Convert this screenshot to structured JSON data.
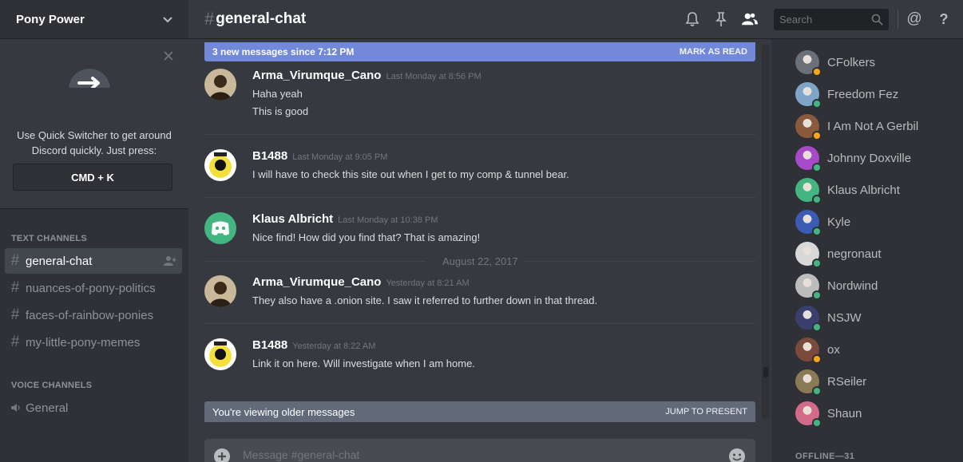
{
  "guild": {
    "name": "Pony Power"
  },
  "quick_switcher": {
    "text": "Use Quick Switcher to get around Discord quickly. Just press:",
    "shortcut": "CMD + K"
  },
  "categories": {
    "text": "TEXT CHANNELS",
    "voice": "VOICE CHANNELS"
  },
  "text_channels": [
    {
      "name": "general-chat",
      "active": true
    },
    {
      "name": "nuances-of-pony-politics"
    },
    {
      "name": "faces-of-rainbow-ponies"
    },
    {
      "name": "my-little-pony-memes"
    }
  ],
  "voice_channels": [
    {
      "name": "General"
    }
  ],
  "header": {
    "channel": "general-chat",
    "search_placeholder": "Search"
  },
  "new_messages": {
    "text": "3 new messages since 7:12 PM",
    "action": "MARK AS READ"
  },
  "messages": [
    {
      "author": "Arma_Virumque_Cano",
      "time": "Last Monday at 8:56 PM",
      "lines": [
        "Haha yeah",
        "This is good"
      ]
    },
    {
      "author": "B1488",
      "time": "Last Monday at 9:05 PM",
      "lines": [
        "I will have to check this site out when I get to my comp & tunnel bear."
      ]
    },
    {
      "author": "Klaus Albricht",
      "time": "Last Monday at 10:38 PM",
      "lines": [
        "Nice find! How did you find that? That is amazing!"
      ]
    },
    {
      "author": "Arma_Virumque_Cano",
      "time": "Yesterday at 8:21 AM",
      "lines": [
        "They also have a .onion site. I saw it referred to further down in that thread."
      ]
    },
    {
      "author": "B1488",
      "time": "Yesterday at 8:22 AM",
      "lines": [
        "Link it on here. Will investigate when I am home."
      ]
    }
  ],
  "date_divider": "August 22, 2017",
  "older_banner": {
    "text": "You're viewing older messages",
    "action": "JUMP TO PRESENT"
  },
  "composer": {
    "placeholder": "Message #general-chat"
  },
  "members": [
    {
      "name": "CFolkers",
      "status": "idle",
      "color": "#6b6f78"
    },
    {
      "name": "Freedom Fez",
      "status": "online",
      "color": "#7fa6c9"
    },
    {
      "name": "I Am Not A Gerbil",
      "status": "idle",
      "color": "#8a5a3c"
    },
    {
      "name": "Johnny Doxville",
      "status": "online",
      "color": "#a64ac9"
    },
    {
      "name": "Klaus Albricht",
      "status": "online",
      "color": "#43b581"
    },
    {
      "name": "Kyle",
      "status": "online",
      "color": "#3b5bb5"
    },
    {
      "name": "negronaut",
      "status": "online",
      "color": "#d8d8d8"
    },
    {
      "name": "Nordwind",
      "status": "online",
      "color": "#bcbcbc"
    },
    {
      "name": "NSJW",
      "status": "online",
      "color": "#3a3f6e"
    },
    {
      "name": "ox",
      "status": "idle",
      "color": "#7a4b3a"
    },
    {
      "name": "RSeiler",
      "status": "online",
      "color": "#8a7a55"
    },
    {
      "name": "Shaun",
      "status": "online",
      "color": "#d26a8a"
    }
  ],
  "offline_header": "OFFLINE—31",
  "status_colors": {
    "online": "#43b581",
    "idle": "#faa61a"
  },
  "accent": "#7289da"
}
